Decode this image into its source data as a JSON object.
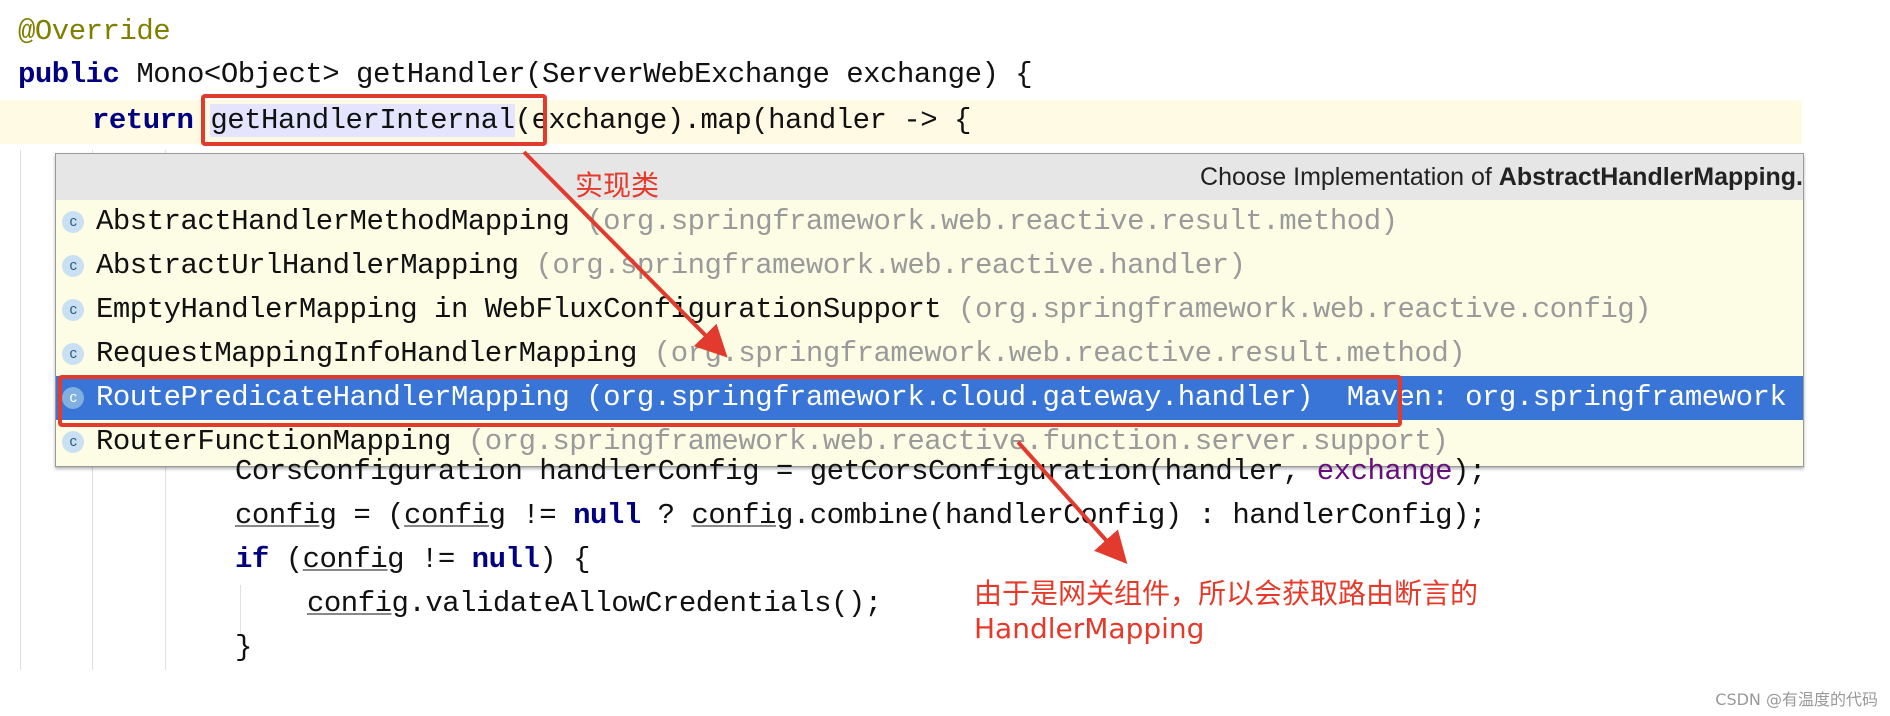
{
  "code_before": {
    "line1": "@Override",
    "line2_kw": "public",
    "line2_rest": " Mono<Object> getHandler(ServerWebExchange exchange) {",
    "line3_kw": "return",
    "line3_method": "getHandlerInternal",
    "line3_rest": "(exchange).map(handler -> {"
  },
  "popup": {
    "title_prefix": "Choose Implementation of ",
    "title_class": "AbstractHandlerMapping.",
    "items": [
      {
        "name": "AbstractHandlerMethodMapping",
        "pkg": " (org.springframework.web.reactive.result.method)",
        "selected": false
      },
      {
        "name": "AbstractUrlHandlerMapping",
        "pkg": " (org.springframework.web.reactive.handler)",
        "selected": false
      },
      {
        "name": "EmptyHandlerMapping in WebFluxConfigurationSupport",
        "pkg": " (org.springframework.web.reactive.config)",
        "selected": false
      },
      {
        "name": "RequestMappingInfoHandlerMapping",
        "pkg": " (org.springframework.web.reactive.result.method)",
        "selected": false
      },
      {
        "name": "RoutePredicateHandlerMapping",
        "pkg": " (org.springframework.cloud.gateway.handler)  Maven: org.springframework",
        "selected": true
      },
      {
        "name": "RouterFunctionMapping",
        "pkg": " (org.springframework.web.reactive.function.server.support)",
        "selected": false
      }
    ],
    "selected_color": "#3875d7",
    "icon": "class-icon",
    "icon_letter": "c"
  },
  "code_after": {
    "l1a": "CorsConfiguration handlerConfig = getCorsConfiguration(handler, ",
    "l1b": "exchange",
    "l1c": ");",
    "l2a": "config",
    "l2b": " = (",
    "l2c": "config",
    "l2d": " != ",
    "l2e": "null",
    "l2f": " ? ",
    "l2g": "config",
    "l2h": ".combine(handlerConfig) : handlerConfig);",
    "l3a": "if",
    "l3b": " (",
    "l3c": "config",
    "l3d": " != ",
    "l3e": "null",
    "l3f": ") {",
    "l4a": "config",
    "l4b": ".validateAllowCredentials();",
    "l5": "}"
  },
  "annotations": {
    "label1": "实现类",
    "label2_line1": "由于是网关组件，所以会获取路由断言的",
    "label2_line2": "HandlerMapping",
    "color": "#e23b2e"
  },
  "watermark": "CSDN @有温度的代码"
}
